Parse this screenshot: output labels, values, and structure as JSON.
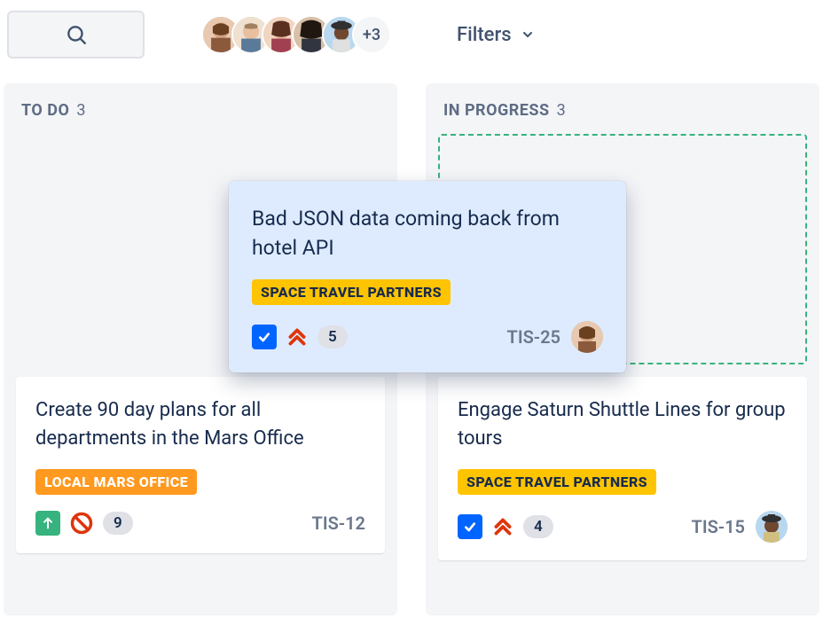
{
  "toolbar": {
    "filters_label": "Filters",
    "avatar_more": "+3"
  },
  "columns": [
    {
      "title": "TO DO",
      "count": "3"
    },
    {
      "title": "IN PROGRESS",
      "count": "3"
    }
  ],
  "cards": {
    "dragged": {
      "title": "Bad JSON data coming back from hotel API",
      "label": "SPACE TRAVEL PARTNERS",
      "label_color": "yellow",
      "type_icon": "task-icon",
      "priority_icon": "priority-highest-icon",
      "points": "5",
      "key": "TIS-25"
    },
    "todo_card": {
      "title": "Create 90 day plans for all departments in the Mars Office",
      "label": "LOCAL MARS OFFICE",
      "label_color": "orange",
      "type_icon": "story-icon",
      "priority_icon": "blocker-icon",
      "points": "9",
      "key": "TIS-12"
    },
    "progress_card": {
      "title": "Engage Saturn Shuttle Lines for group tours",
      "label": "SPACE TRAVEL PARTNERS",
      "label_color": "yellow",
      "type_icon": "task-icon",
      "priority_icon": "priority-highest-icon",
      "points": "4",
      "key": "TIS-15"
    }
  },
  "colors": {
    "accent": "#0065ff",
    "column_bg": "#f4f5f7",
    "drop_border": "#36b37e"
  }
}
